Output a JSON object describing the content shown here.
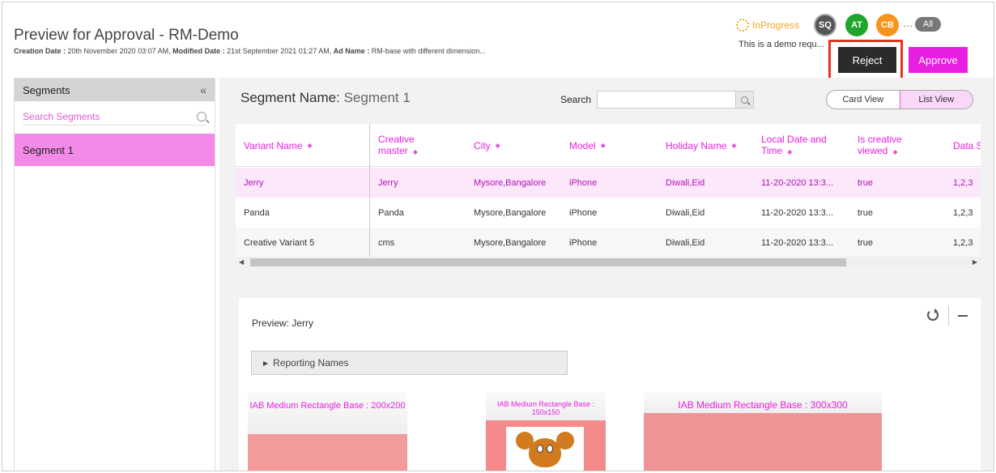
{
  "header": {
    "title": "Preview for Approval - RM-Demo",
    "creation_label": "Creation Date :",
    "creation_value": "20th November 2020 03:07 AM,",
    "modified_label": "Modified Date :",
    "modified_value": "21st September 2021 01:27 AM,",
    "adname_label": "Ad Name :",
    "adname_value": "RM-base with different dimension...",
    "status": "InProgress",
    "avatars": [
      "SQ",
      "AT",
      "CB"
    ],
    "more": "...",
    "all_label": "All",
    "demo_text": "This is a demo requ...",
    "reject_label": "Reject",
    "approve_label": "Approve"
  },
  "sidebar": {
    "title": "Segments",
    "collapse_glyph": "«",
    "search_placeholder": "Search Segments",
    "items": [
      {
        "label": "Segment 1"
      }
    ]
  },
  "main": {
    "segment_name_label": "Segment Name:",
    "segment_name_value": "Segment 1",
    "search_label": "Search",
    "card_view_label": "Card View",
    "list_view_label": "List View"
  },
  "table": {
    "columns": [
      {
        "label_1": "Variant Name",
        "label_2": ""
      },
      {
        "label_1": "Creative",
        "label_2": "master"
      },
      {
        "label_1": "City",
        "label_2": ""
      },
      {
        "label_1": "Model",
        "label_2": ""
      },
      {
        "label_1": "Holiday Name",
        "label_2": ""
      },
      {
        "label_1": "Local Date and",
        "label_2": "Time"
      },
      {
        "label_1": "Is creative",
        "label_2": "viewed"
      },
      {
        "label_1": "Data S",
        "label_2": ""
      }
    ],
    "rows": [
      [
        "Jerry",
        "Jerry",
        "Mysore,Bangalore",
        "iPhone",
        "Diwali,Eid",
        "11-20-2020 13:3...",
        "true",
        "1,2,3"
      ],
      [
        "Panda",
        "Panda",
        "Mysore,Bangalore",
        "iPhone",
        "Diwali,Eid",
        "11-20-2020 13:3...",
        "true",
        "1,2,3"
      ],
      [
        "Creative Variant 5",
        "cms",
        "Mysore,Bangalore",
        "iPhone",
        "Diwali,Eid",
        "11-20-2020 13:3...",
        "true",
        "1,2,3"
      ]
    ],
    "selected_row": 0
  },
  "preview": {
    "label": "Preview: Jerry",
    "reporting_label": "Reporting Names",
    "cards": [
      {
        "title": "IAB Medium Rectangle Base : 200x200"
      },
      {
        "title": "IAB Medium Rectangle Base : 150x150"
      },
      {
        "title": "IAB Medium Rectangle Base : 300x300"
      }
    ]
  },
  "colors": {
    "accent": "#e81ee0",
    "reject_bg": "#2b2b2b",
    "highlight_outline": "#e8341c",
    "status": "#f5a623"
  }
}
